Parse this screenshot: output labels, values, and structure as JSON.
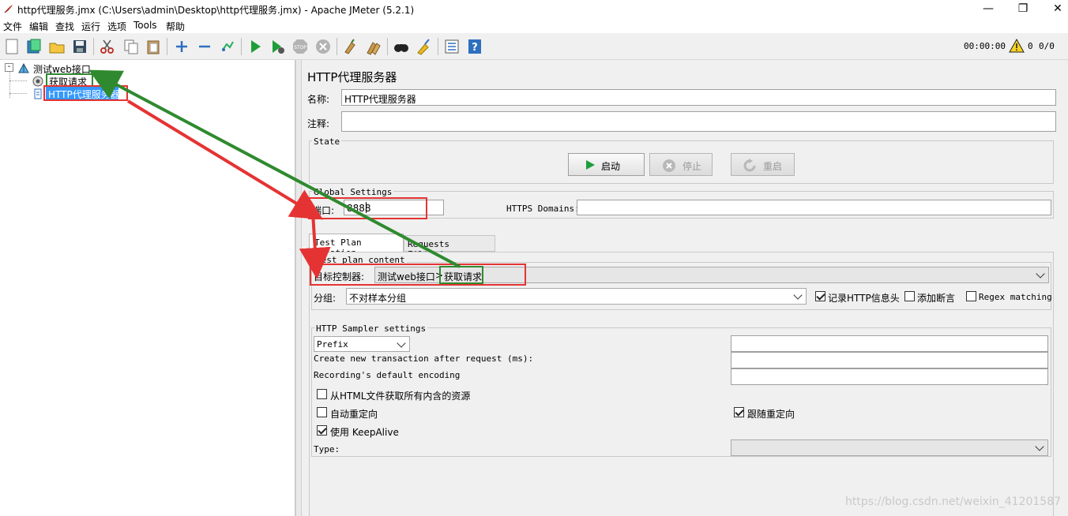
{
  "window": {
    "title": "http代理服务.jmx (C:\\Users\\admin\\Desktop\\http代理服务.jmx) - Apache JMeter (5.2.1)",
    "minimize": "—",
    "maximize": "❐",
    "close": "✕"
  },
  "menu": [
    "文件",
    "编辑",
    "查找",
    "运行",
    "选项",
    "Tools",
    "帮助"
  ],
  "toolbar": {
    "icons": [
      "new-icon",
      "templates-icon",
      "open-icon",
      "save-icon",
      "cut-icon",
      "copy-icon",
      "paste-icon",
      "expand-icon",
      "collapse-icon",
      "toggle-icon",
      "start-icon",
      "start-no-pause-icon",
      "stop-icon",
      "shutdown-icon",
      "clear-icon",
      "clear-all-icon",
      "search-icon",
      "reset-search-icon",
      "function-helper-icon",
      "help-icon"
    ],
    "timer": "00:00:00",
    "warn_count": "0",
    "threads": "0/0"
  },
  "tree": {
    "root": "测试web接口",
    "children": [
      "获取请求",
      "HTTP代理服务器"
    ]
  },
  "panel": {
    "heading": "HTTP代理服务器",
    "name_label": "名称:",
    "name_value": "HTTP代理服务器",
    "comment_label": "注释:",
    "comment_value": "",
    "state_legend": "State",
    "btn_start": "启动",
    "btn_stop": "停止",
    "btn_restart": "重启",
    "global_legend": "Global Settings",
    "port_label": "端口:",
    "port_value": "8888",
    "https_label": "HTTPS Domains:",
    "https_value": "",
    "tabs": [
      "Test Plan Creation",
      "Requests Filtering"
    ],
    "test_plan_content_legend": "Test plan content",
    "target_label": "目标控制器:",
    "target_value_a": "测试web接口",
    "target_sep": ">",
    "target_value_b": "获取请求",
    "group_label": "分组:",
    "group_value": "不对样本分组",
    "cb_record_headers": "记录HTTP信息头",
    "cb_add_assertions": "添加断言",
    "cb_regex": "Regex matching",
    "sampler_legend": "HTTP Sampler settings",
    "prefix_value": "Prefix",
    "create_tx_label": "Create new transaction after request (ms):",
    "encoding_label": "Recording's default encoding",
    "cb_retrieve": "从HTML文件获取所有内含的资源",
    "cb_auto_redirect": "自动重定向",
    "cb_follow_redirect": "跟随重定向",
    "cb_keepalive": "使用 KeepAlive",
    "type_label": "Type:"
  },
  "watermark": "https://blog.csdn.net/weixin_41201587",
  "colors": {
    "annotation_red": "#e53333",
    "annotation_green": "#2f8a2f",
    "selection": "#3399ff"
  }
}
